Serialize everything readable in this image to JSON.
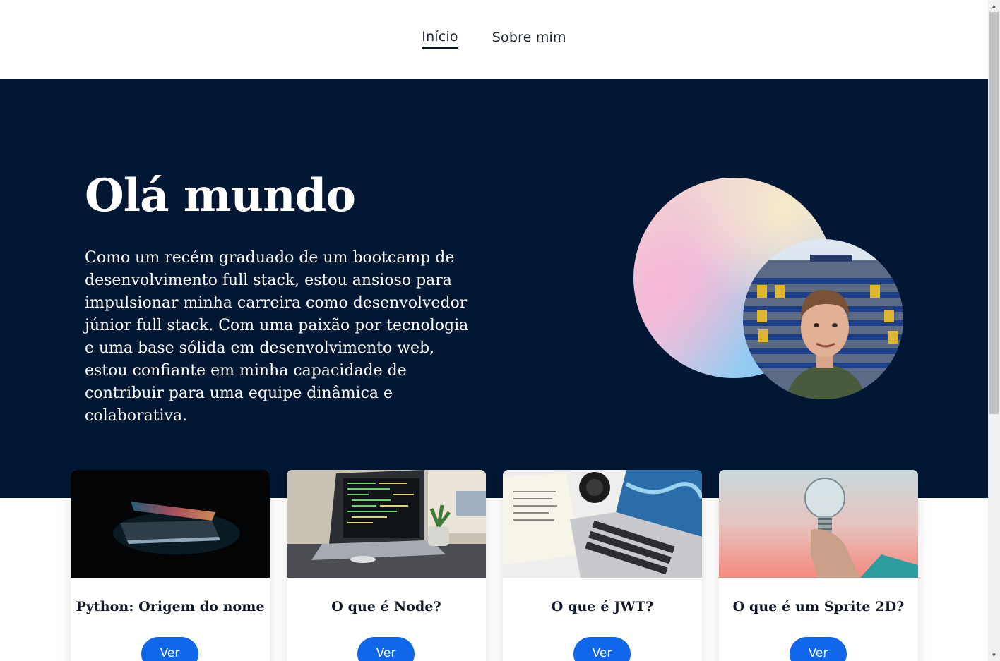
{
  "nav": {
    "items": [
      {
        "label": "Início",
        "active": true
      },
      {
        "label": "Sobre mim",
        "active": false
      }
    ]
  },
  "hero": {
    "title": "Olá mundo",
    "text": "Como um recém graduado de um bootcamp de desenvolvimento full stack, estou ansioso para impulsionar minha carreira como desenvolvedor júnior full stack. Com uma paixão por tecnologia e uma base sólida em desenvolvimento web, estou confiante em minha capacidade de contribuir para uma equipe dinâmica e colaborativa.",
    "background_color": "#021733"
  },
  "cards": [
    {
      "title": "Python: Origem do nome",
      "button": "Ver"
    },
    {
      "title": "O que é Node?",
      "button": "Ver"
    },
    {
      "title": "O que é JWT?",
      "button": "Ver"
    },
    {
      "title": "O que é um Sprite 2D?",
      "button": "Ver"
    }
  ],
  "colors": {
    "accent": "#1167ea",
    "navy": "#021733"
  }
}
